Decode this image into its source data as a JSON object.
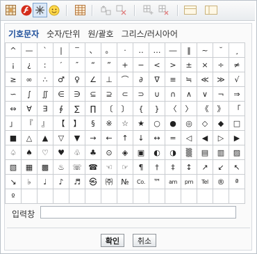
{
  "toolbar": {
    "buttons": [
      {
        "icon": "table-icon"
      },
      {
        "icon": "flash-icon"
      },
      {
        "icon": "special-char-icon"
      },
      {
        "icon": "emoticon-icon"
      },
      {
        "icon": "insert-table-icon"
      },
      {
        "icon": "merge-cells-icon"
      },
      {
        "icon": "delete-cells-icon"
      },
      {
        "icon": "insert-cells-icon"
      },
      {
        "icon": "remove-cells-icon"
      },
      {
        "icon": "row-layout-icon"
      },
      {
        "icon": "column-layout-icon"
      }
    ],
    "accent": "#7ea3cf"
  },
  "tabs": [
    "기호문자",
    "숫자/단위",
    "원/괄호",
    "그리스/러시아어"
  ],
  "active_tab": 0,
  "grid": [
    [
      "^",
      "—",
      "`",
      "|",
      "‾",
      "、",
      "。",
      "·",
      "‥",
      "…",
      "―",
      "‖",
      "~",
      "˘",
      "¸"
    ],
    [
      "¡",
      "¿",
      "ː",
      "′",
      "″",
      "“",
      "”",
      "+",
      "−",
      "<",
      ">",
      "±",
      "×",
      "÷",
      "≠"
    ],
    [
      "≥",
      "∞",
      "∴",
      "♂",
      "♀",
      "∠",
      "⊥",
      "⌒",
      "∂",
      "∇",
      "≡",
      "≒",
      "≪",
      "≫",
      "√"
    ],
    [
      "∽",
      "∫",
      "∬",
      "∈",
      "∋",
      "⊆",
      "⊇",
      "⊂",
      "⊃",
      "∪",
      "∩",
      "∧",
      "∨",
      "¬",
      "⇒"
    ],
    [
      "⇔",
      "∀",
      "∃",
      "∮",
      "∑",
      "∏",
      "〔",
      "〕",
      "{",
      "}",
      "〈",
      "〉",
      "《",
      "》",
      "「"
    ],
    [
      "」",
      "『",
      "』",
      "【",
      "】",
      "§",
      "※",
      "☆",
      "★",
      "○",
      "●",
      "◎",
      "◇",
      "◆",
      "□"
    ],
    [
      "■",
      "△",
      "▲",
      "▽",
      "▼",
      "→",
      "←",
      "↑",
      "↓",
      "↔",
      "=",
      "◁",
      "◀",
      "▷",
      "▶"
    ],
    [
      "♤",
      "♠",
      "♡",
      "♥",
      "♧",
      "♣",
      "⊙",
      "◈",
      "▣",
      "◐",
      "◑",
      "▒",
      "▤",
      "▥",
      "▨"
    ],
    [
      "▧",
      "▦",
      "▩",
      "♨",
      "☏",
      "☎",
      "☜",
      "☞",
      "¶",
      "†",
      "‡",
      "↕",
      "↗",
      "↙",
      "↖"
    ],
    [
      "↘",
      "♭",
      "♩",
      "♪",
      "♬",
      "㉿",
      "㈜",
      "№",
      "Co.",
      "™",
      "am",
      "pm",
      "Tel",
      "®",
      "ª"
    ],
    [
      "º",
      "",
      "",
      "",
      "",
      "",
      "",
      "",
      "",
      "",
      "",
      "",
      "",
      "",
      ""
    ]
  ],
  "input": {
    "label": "입력창",
    "value": ""
  },
  "buttons": {
    "ok": "확인",
    "cancel": "취소"
  }
}
